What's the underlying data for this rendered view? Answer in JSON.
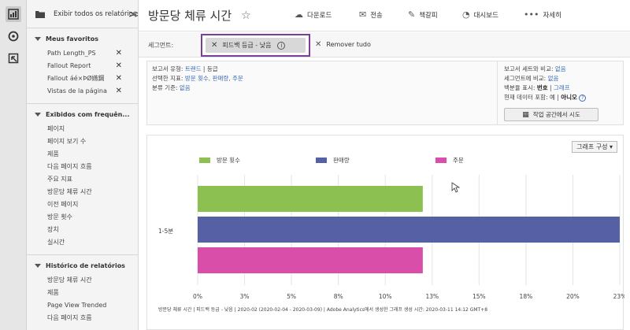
{
  "sidebar": {
    "toggle_label": "Exibir todos os relatórios",
    "sections": [
      {
        "title": "Meus favoritos",
        "items": [
          {
            "label": "Path Length_PS",
            "removable": true
          },
          {
            "label": "Fallout Report",
            "removable": true
          },
          {
            "label": "Fallout áé×ÞØ嬿鋼",
            "removable": true
          },
          {
            "label": "Vistas de la página",
            "removable": true
          }
        ]
      },
      {
        "title": "Exibidos com frequên...",
        "items": [
          {
            "label": "페이지"
          },
          {
            "label": "페이지 보기 수"
          },
          {
            "label": "제품"
          },
          {
            "label": "다음 페이지 흐름"
          },
          {
            "label": "주요 지표"
          },
          {
            "label": "방문당 체류 시간"
          },
          {
            "label": "이전 페이지"
          },
          {
            "label": "방문 횟수"
          },
          {
            "label": "장치"
          },
          {
            "label": "실시간"
          }
        ]
      },
      {
        "title": "Histórico de relatórios",
        "items": [
          {
            "label": "방문당 체류 시간"
          },
          {
            "label": "제품"
          },
          {
            "label": "Page View Trended"
          },
          {
            "label": "다음 페이지 흐름"
          }
        ]
      }
    ]
  },
  "header": {
    "title": "방문당 체류 시간",
    "actions": {
      "download": "다운로드",
      "send": "전송",
      "bookmark": "책갈피",
      "dashboard": "대시보드",
      "more": "자세히"
    }
  },
  "segment": {
    "label": "세그먼트:",
    "chip": "피드백 등급 - 낮음",
    "remove_all": "Remover tudo"
  },
  "info": {
    "report_type_label": "보고서 유형:",
    "report_type_link": "트랜드",
    "report_type_sep": " | ",
    "report_type_value": "등급",
    "metrics_label": "선택한 지표:",
    "metrics_link": "방문 횟수, 판매량, 주문",
    "breakdown_label": "분류 기준:",
    "breakdown_link": "없음",
    "compare_label": "보고서 세트와 비교:",
    "compare_link": "없음",
    "segment_compare_label": "세그먼트에 비교:",
    "segment_compare_link": "없음",
    "percent_label": "백분율 표시:",
    "percent_value": "번호",
    "percent_sep": " | ",
    "percent_link": "그래프",
    "current_data_label": "현재 데이터 포함:",
    "current_data_yes": "예",
    "current_data_sep": " | ",
    "current_data_no": "아니오",
    "try_button": "작업 공간에서 시도"
  },
  "chart_config_label": "그래프 구성 ▾",
  "chart_data": {
    "type": "bar",
    "orientation": "horizontal",
    "categories": [
      "1-5분"
    ],
    "series": [
      {
        "name": "방문 횟수",
        "values": [
          12
        ],
        "color": "#8cc152"
      },
      {
        "name": "판매량",
        "values": [
          22.5
        ],
        "color": "#5560a5"
      },
      {
        "name": "주문",
        "values": [
          12
        ],
        "color": "#d94ea8"
      }
    ],
    "xticks": [
      "0%",
      "3%",
      "5%",
      "8%",
      "10%",
      "13%",
      "15%",
      "18%",
      "20%",
      "23%"
    ],
    "xlim": [
      0,
      22.5
    ],
    "grid": true,
    "legend": "top"
  },
  "footer_note": "방문당 체류 시간 | 피드백 등급 - 낮음 | 2020-02 (2020-02-04 - 2020-03-09) | Adobe Analytics에서 생성한 그래프 생성 시간: 2020-03-11 14:12 GMT+8",
  "colors": {
    "segment_highlight": "#7a3e9d",
    "link": "#3a6db5"
  }
}
